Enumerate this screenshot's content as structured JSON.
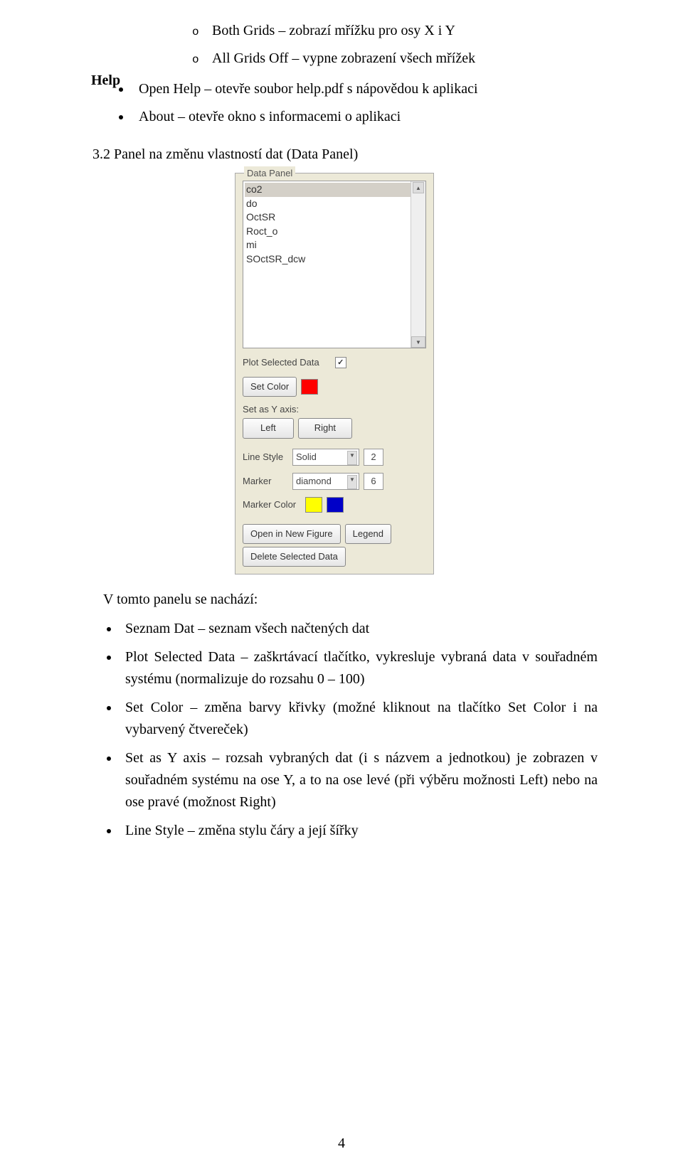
{
  "subitems": {
    "both_grids": "Both Grids – zobrazí mřížku pro osy X i Y",
    "all_off": "All Grids Off – vypne zobrazení všech mřížek"
  },
  "help_label": "Help",
  "help_items": {
    "open": "Open Help – otevře soubor help.pdf s nápovědou k aplikaci",
    "about": "About – otevře okno s informacemi o aplikaci"
  },
  "section_heading": "3.2  Panel na změnu vlastností dat (Data Panel)",
  "panel": {
    "title": "Data Panel",
    "list": [
      "co2",
      "do",
      "OctSR",
      "Roct_o",
      "mi",
      "SOctSR_dcw"
    ],
    "plot_label": "Plot Selected Data",
    "checkbox_mark": "✓",
    "set_color_btn": "Set Color",
    "swatch1": "#ff0000",
    "set_axis_label": "Set as Y axis:",
    "left_btn": "Left",
    "right_btn": "Right",
    "linestyle_label": "Line Style",
    "linestyle_val": "Solid",
    "linestyle_num": "2",
    "marker_label": "Marker",
    "marker_val": "diamond",
    "marker_num": "6",
    "markercolor_label": "Marker Color",
    "swatch2": "#ffff00",
    "swatch3": "#0000c8",
    "open_fig_btn": "Open in New Figure",
    "legend_btn": "Legend",
    "delete_btn": "Delete Selected Data"
  },
  "after_panel_intro": "V tomto panelu se nachází:",
  "bullets": [
    "Seznam Dat – seznam všech načtených dat",
    "Plot Selected Data – zaškrtávací tlačítko, vykresluje vybraná data v souřadném systému (normalizuje do rozsahu 0 – 100)",
    "Set Color – změna barvy křivky (možné kliknout na tlačítko Set Color i na vybarvený čtvereček)",
    "Set as Y axis – rozsah vybraných dat (i s názvem a jednotkou) je zobrazen v souřadném systému na ose Y, a to na ose levé (při výběru možnosti Left) nebo na ose pravé (možnost Right)",
    "Line Style – změna stylu čáry a její šířky"
  ],
  "page_number": "4"
}
